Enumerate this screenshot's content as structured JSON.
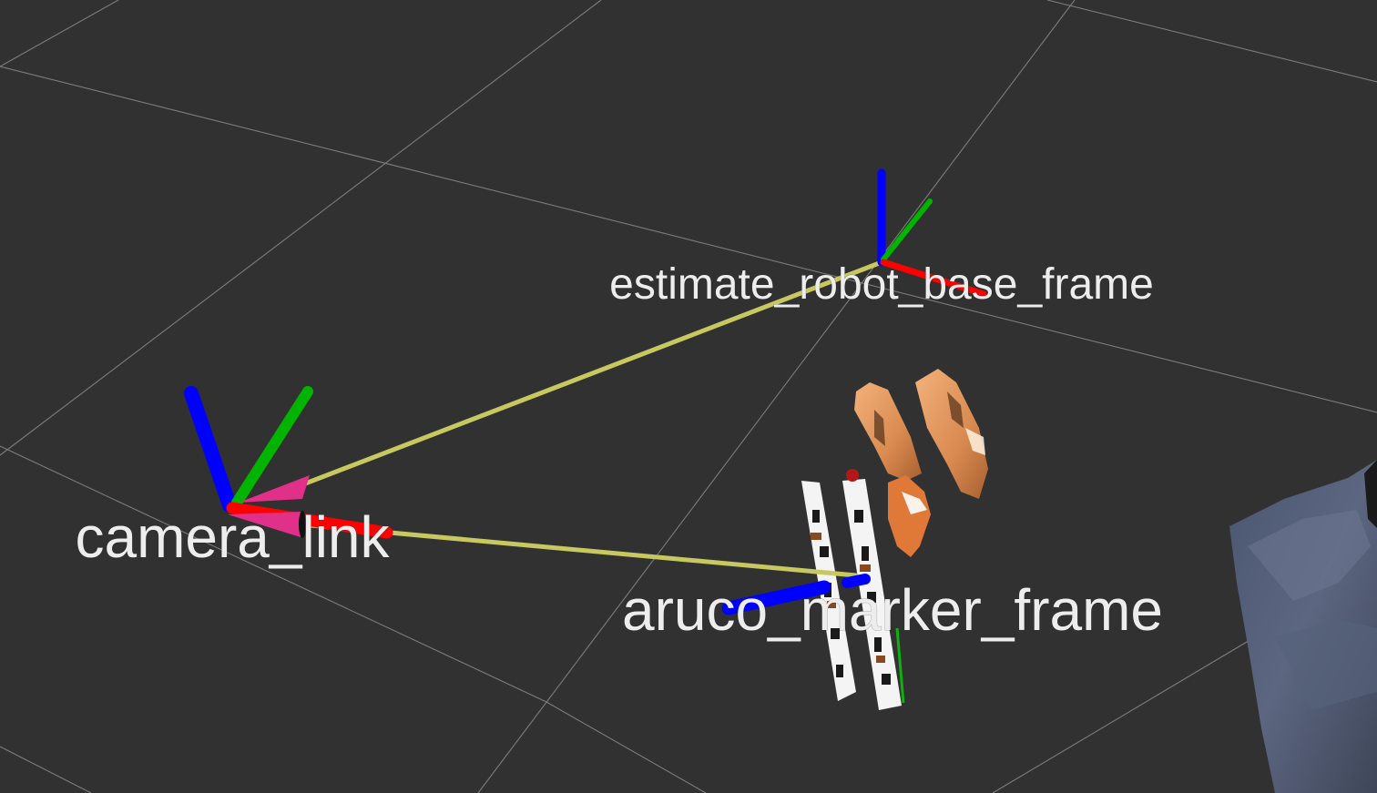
{
  "viewport": {
    "background": "#313131",
    "grid_color": "#a0a0a0"
  },
  "frames": {
    "estimate_robot_base": {
      "label": "estimate_robot_base_frame"
    },
    "camera_link": {
      "label": "camera_link"
    },
    "aruco_marker": {
      "label": "aruco_marker_frame"
    }
  },
  "colors": {
    "axis_x": "#ff0000",
    "axis_y": "#00b400",
    "axis_z": "#0000ff",
    "tf_link": "#c8c860",
    "arrow_head": "#e0308a"
  }
}
